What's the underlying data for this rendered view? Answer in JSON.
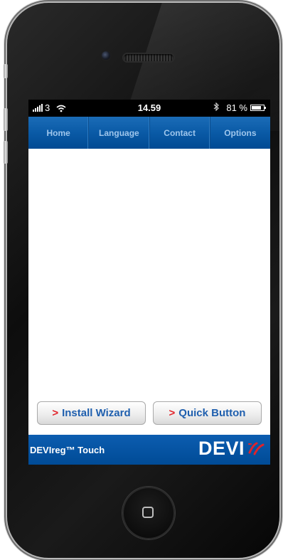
{
  "status_bar": {
    "carrier": "3",
    "time": "14.59",
    "battery": "81 %",
    "battery_level": 0.81,
    "icons": [
      "signal-bars-icon",
      "wifi-icon",
      "bluetooth-icon",
      "battery-icon"
    ]
  },
  "nav": {
    "items": [
      {
        "label": "Home"
      },
      {
        "label": "Language"
      },
      {
        "label": "Contact"
      },
      {
        "label": "Options"
      }
    ]
  },
  "buttons": {
    "arrow": ">",
    "install": "Install Wizard",
    "quick": "Quick Button"
  },
  "footer": {
    "product": "DEVIreg™ Touch",
    "brand": "DEVI"
  },
  "colors": {
    "nav_blue": "#0a5aa6",
    "footer_blue": "#004b96",
    "accent_red": "#e1232a",
    "button_text": "#1f5fae"
  }
}
